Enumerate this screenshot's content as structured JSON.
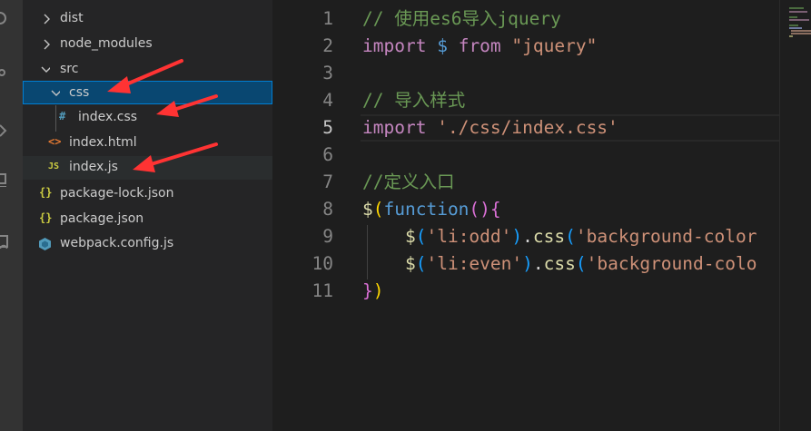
{
  "colors": {
    "selection": "#094771",
    "selection_border": "#007fd4",
    "arrow": "#ff3333",
    "comment": "#6a9955",
    "keyword": "#c586c0",
    "string": "#ce9178",
    "function": "#dcdcaa",
    "keyword_blue": "#569cd6"
  },
  "activity_bar": {
    "icons": [
      "explorer-icon",
      "source-control-icon",
      "run-debug-icon",
      "extensions-icon",
      "remote-icon"
    ]
  },
  "explorer": {
    "items": [
      {
        "label": "dist",
        "kind": "folder",
        "state": "collapsed",
        "icon": "chevron-right-icon"
      },
      {
        "label": "node_modules",
        "kind": "folder",
        "state": "collapsed",
        "icon": "chevron-right-icon"
      },
      {
        "label": "src",
        "kind": "folder",
        "state": "expanded",
        "icon": "chevron-down-icon"
      },
      {
        "label": "css",
        "kind": "folder",
        "state": "expanded",
        "selected": true,
        "icon": "chevron-down-icon"
      },
      {
        "label": "index.css",
        "kind": "file",
        "icon": "css-file-icon",
        "glyph": "#"
      },
      {
        "label": "index.html",
        "kind": "file",
        "icon": "html-file-icon",
        "glyph": "<>"
      },
      {
        "label": "index.js",
        "kind": "file",
        "icon": "js-file-icon",
        "glyph": "JS",
        "hovered": true
      },
      {
        "label": "package-lock.json",
        "kind": "file",
        "icon": "json-file-icon",
        "glyph": "{}"
      },
      {
        "label": "package.json",
        "kind": "file",
        "icon": "json-file-icon",
        "glyph": "{}"
      },
      {
        "label": "webpack.config.js",
        "kind": "file",
        "icon": "webpack-file-icon"
      }
    ]
  },
  "editor": {
    "active_line": 5,
    "lines": [
      {
        "num": "1",
        "tokens": [
          {
            "t": "// 使用es6导入jquery",
            "c": "com"
          }
        ]
      },
      {
        "num": "2",
        "tokens": [
          {
            "t": "import",
            "c": "kw"
          },
          {
            "t": " ",
            "c": "pl"
          },
          {
            "t": "$",
            "c": "blue"
          },
          {
            "t": " ",
            "c": "pl"
          },
          {
            "t": "from",
            "c": "kw"
          },
          {
            "t": " ",
            "c": "pl"
          },
          {
            "t": "\"jquery\"",
            "c": "str"
          }
        ]
      },
      {
        "num": "3",
        "tokens": []
      },
      {
        "num": "4",
        "tokens": [
          {
            "t": "// 导入样式",
            "c": "com"
          }
        ]
      },
      {
        "num": "5",
        "tokens": [
          {
            "t": "import",
            "c": "kw"
          },
          {
            "t": " ",
            "c": "pl"
          },
          {
            "t": "'./css/index.css'",
            "c": "str"
          }
        ]
      },
      {
        "num": "6",
        "tokens": []
      },
      {
        "num": "7",
        "tokens": [
          {
            "t": "//定义入口",
            "c": "com"
          }
        ]
      },
      {
        "num": "8",
        "tokens": [
          {
            "t": "$",
            "c": "fn"
          },
          {
            "t": "(",
            "c": "br1"
          },
          {
            "t": "function",
            "c": "blue"
          },
          {
            "t": "()",
            "c": "br2"
          },
          {
            "t": "{",
            "c": "br2"
          }
        ]
      },
      {
        "num": "9",
        "tokens": [
          {
            "t": "    ",
            "c": "pl"
          },
          {
            "t": "$",
            "c": "fn"
          },
          {
            "t": "(",
            "c": "br3"
          },
          {
            "t": "'li:odd'",
            "c": "str"
          },
          {
            "t": ")",
            "c": "br3"
          },
          {
            "t": ".",
            "c": "pl"
          },
          {
            "t": "css",
            "c": "fn"
          },
          {
            "t": "(",
            "c": "br3"
          },
          {
            "t": "'background-color",
            "c": "str"
          }
        ]
      },
      {
        "num": "10",
        "tokens": [
          {
            "t": "    ",
            "c": "pl"
          },
          {
            "t": "$",
            "c": "fn"
          },
          {
            "t": "(",
            "c": "br3"
          },
          {
            "t": "'li:even'",
            "c": "str"
          },
          {
            "t": ")",
            "c": "br3"
          },
          {
            "t": ".",
            "c": "pl"
          },
          {
            "t": "css",
            "c": "fn"
          },
          {
            "t": "(",
            "c": "br3"
          },
          {
            "t": "'background-colo",
            "c": "str"
          }
        ]
      },
      {
        "num": "11",
        "tokens": [
          {
            "t": "}",
            "c": "br2"
          },
          {
            "t": ")",
            "c": "br1"
          }
        ]
      }
    ]
  },
  "annotations": {
    "arrows": [
      "annotation-arrow-css",
      "annotation-arrow-index-css",
      "annotation-arrow-index-js"
    ]
  }
}
